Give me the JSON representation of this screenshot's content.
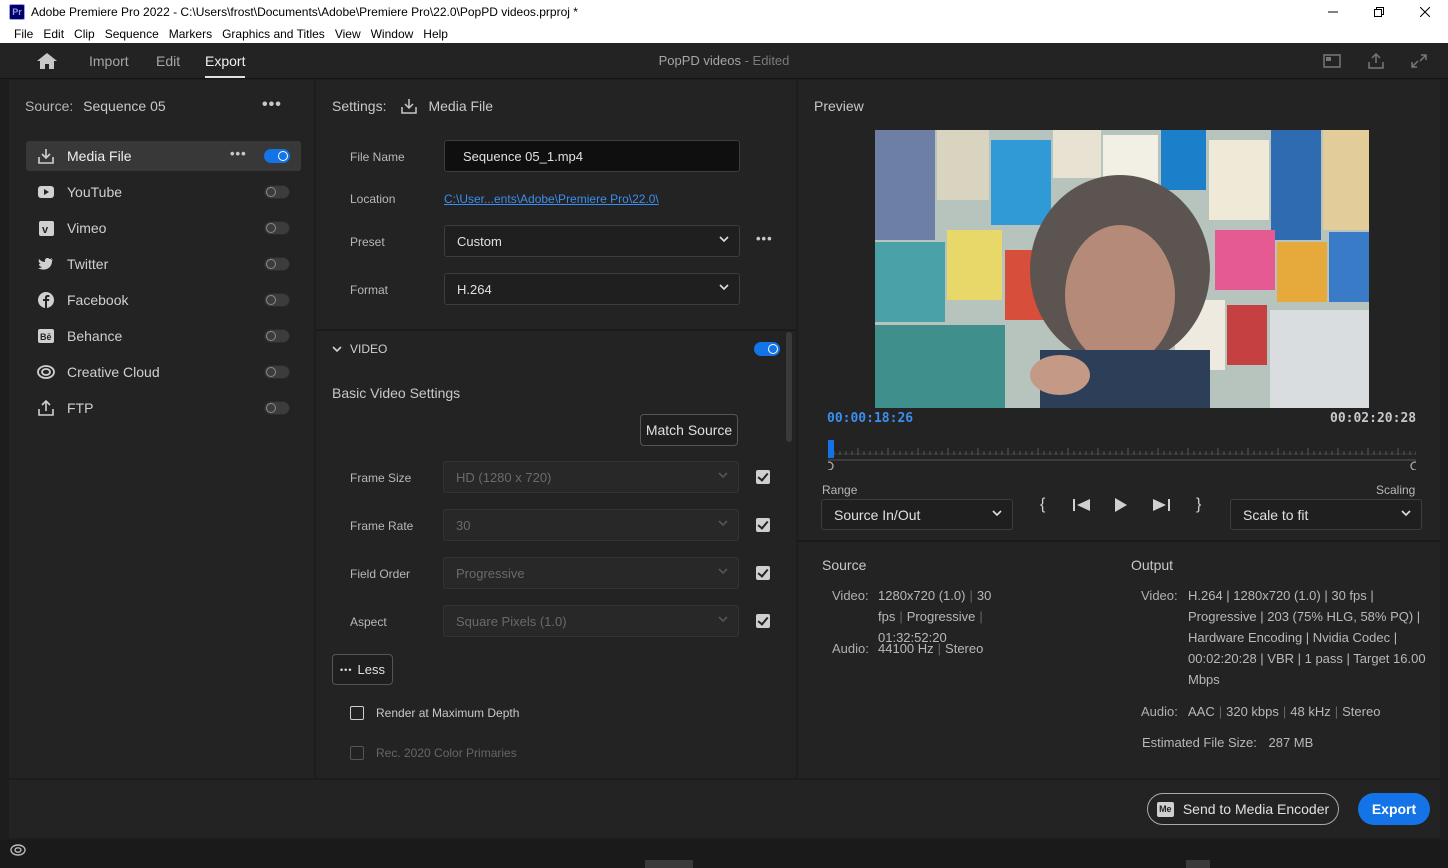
{
  "window": {
    "app_icon": "Pr",
    "title": "Adobe Premiere Pro 2022 - C:\\Users\\frost\\Documents\\Adobe\\Premiere Pro\\22.0\\PopPD videos.prproj *"
  },
  "menu": [
    "File",
    "Edit",
    "Clip",
    "Sequence",
    "Markers",
    "Graphics and Titles",
    "View",
    "Window",
    "Help"
  ],
  "header": {
    "tabs": [
      "Import",
      "Edit",
      "Export"
    ],
    "active_tab": "Export",
    "project_name": "PopPD videos",
    "status": "- Edited"
  },
  "source": {
    "label": "Source:",
    "value": "Sequence 05"
  },
  "destinations": [
    {
      "label": "Media File",
      "icon": "download-icon",
      "enabled": true,
      "selected": true
    },
    {
      "label": "YouTube",
      "icon": "youtube-icon",
      "enabled": false
    },
    {
      "label": "Vimeo",
      "icon": "vimeo-icon",
      "enabled": false
    },
    {
      "label": "Twitter",
      "icon": "twitter-icon",
      "enabled": false
    },
    {
      "label": "Facebook",
      "icon": "facebook-icon",
      "enabled": false
    },
    {
      "label": "Behance",
      "icon": "behance-icon",
      "enabled": false
    },
    {
      "label": "Creative Cloud",
      "icon": "creative-cloud-icon",
      "enabled": false
    },
    {
      "label": "FTP",
      "icon": "upload-icon",
      "enabled": false
    }
  ],
  "settings": {
    "label": "Settings:",
    "title": "Media File",
    "file_name_label": "File Name",
    "file_name": "Sequence 05_1.mp4",
    "location_label": "Location",
    "location": "C:\\User...ents\\Adobe\\Premiere Pro\\22.0\\",
    "preset_label": "Preset",
    "preset": "Custom",
    "format_label": "Format",
    "format": "H.264"
  },
  "video_section": {
    "header": "VIDEO",
    "enabled": true,
    "basic_title": "Basic Video Settings",
    "match_source": "Match Source",
    "fields": [
      {
        "label": "Frame Size",
        "value": "HD (1280 x 720)",
        "checked": true
      },
      {
        "label": "Frame Rate",
        "value": "30",
        "checked": true
      },
      {
        "label": "Field Order",
        "value": "Progressive",
        "checked": true
      },
      {
        "label": "Aspect",
        "value": "Square Pixels (1.0)",
        "checked": true
      }
    ],
    "less_button": "Less",
    "render_max_depth": "Render at Maximum Depth",
    "rec2020": "Rec. 2020 Color Primaries"
  },
  "preview": {
    "label": "Preview",
    "current_time": "00:00:18:26",
    "duration": "00:02:20:28",
    "range_label": "Range",
    "range_value": "Source In/Out",
    "scaling_label": "Scaling",
    "scaling_value": "Scale to fit"
  },
  "summary": {
    "source_title": "Source",
    "output_title": "Output",
    "source_video_label": "Video:",
    "source_video": [
      "1280x720 (1.0)",
      "30 fps",
      "Progressive",
      "01:32:52:20"
    ],
    "source_audio_label": "Audio:",
    "source_audio": [
      "44100 Hz",
      "Stereo"
    ],
    "output_video_label": "Video:",
    "output_video_lines": [
      "H.264 | 1280x720 (1.0) | 30 fps |",
      "Progressive | 203 (75% HLG, 58% PQ) |",
      "Hardware Encoding | Nvidia Codec |",
      "00:02:20:28 | VBR | 1 pass | Target 16.00",
      "Mbps"
    ],
    "output_audio_label": "Audio:",
    "output_audio": [
      "AAC",
      "320 kbps",
      "48 kHz",
      "Stereo"
    ],
    "file_size_label": "Estimated File Size:",
    "file_size": "287 MB"
  },
  "footer": {
    "send_to_encoder": "Send to Media Encoder",
    "encoder_badge": "Me",
    "export": "Export"
  },
  "colors": {
    "accent": "#1473e6",
    "link": "#3b8ef0",
    "panel": "#232323"
  }
}
